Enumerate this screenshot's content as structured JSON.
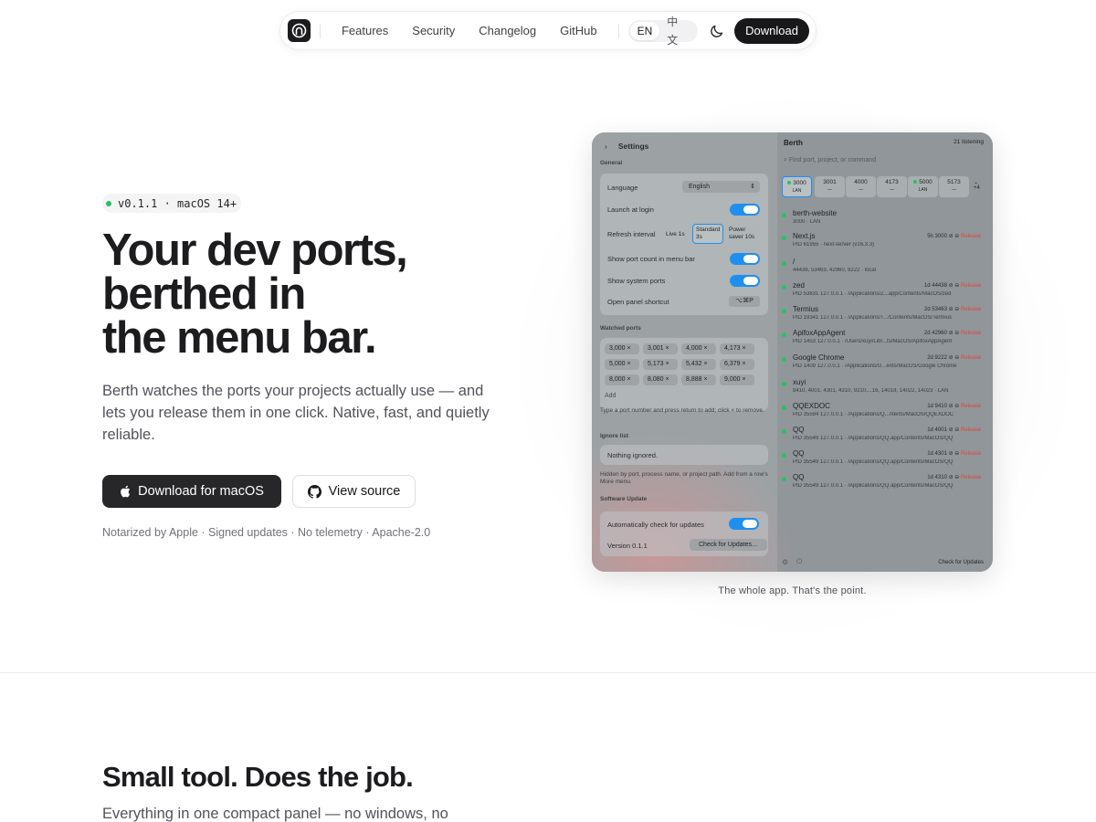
{
  "nav": {
    "links": [
      "Features",
      "Security",
      "Changelog",
      "GitHub"
    ],
    "lang_en": "EN",
    "lang_zh": "中文",
    "download": "Download"
  },
  "hero": {
    "badge": "v0.1.1 · macOS 14+",
    "title_1": "Your dev ports,",
    "title_2": "berthed in",
    "title_3": "the menu bar.",
    "subtitle": "Berth watches the ports your projects actually use — and lets you release them in one click. Native, fast, and quietly reliable.",
    "primary_btn": "Download for macOS",
    "secondary_btn": "View source",
    "trust": "Notarized by Apple · Signed updates · No telemetry · Apache-2.0"
  },
  "app": {
    "settings": {
      "title": "Settings",
      "general": "General",
      "language_label": "Language",
      "language_value": "English",
      "launch_label": "Launch at login",
      "refresh_label": "Refresh interval",
      "refresh_opts": [
        "Live 1s",
        "Standard 3s",
        "Power saver 10s"
      ],
      "menu_count_label": "Show port count in menu bar",
      "system_ports_label": "Show system ports",
      "shortcut_label": "Open panel shortcut",
      "shortcut_value": "⌥⌘P",
      "watched": "Watched ports",
      "chips": [
        "3,000 ×",
        "3,001 ×",
        "4,000 ×",
        "4,173 ×",
        "5,000 ×",
        "5,173 ×",
        "5,432 ×",
        "6,379 ×",
        "8,000 ×",
        "8,080 ×",
        "8,888 ×",
        "9,000 ×"
      ],
      "add": "Add",
      "watched_hint": "Type a port number and press return to add; click × to remove.",
      "ignore": "Ignore list",
      "ignore_empty": "Nothing ignored.",
      "ignore_hint": "Hidden by port, process name, or project path. Add from a row's More menu.",
      "update": "Software Update",
      "auto_update": "Automatically check for updates",
      "version": "Version 0.1.1",
      "check_btn": "Check for Updates…"
    },
    "list": {
      "title": "Berth",
      "count": "21 listening",
      "search": "Find port, project, or command",
      "tabs": [
        {
          "port": "3000",
          "sub": "LAN"
        },
        {
          "port": "3001",
          "sub": "—"
        },
        {
          "port": "4000",
          "sub": "—"
        },
        {
          "port": "4173",
          "sub": "—"
        },
        {
          "port": "5000",
          "sub": "LAN"
        },
        {
          "port": "5173",
          "sub": "—"
        }
      ],
      "tabs_more": "+4",
      "items": [
        {
          "name": "berth-website",
          "det": "3000 · LAN",
          "meta": ""
        },
        {
          "name": "Next.js",
          "det": "PID 61955 · next-server (v16.3.3)",
          "meta": "5h 3000"
        },
        {
          "name": "/",
          "det": "44438, 53463, 42960, 9222 · local",
          "meta": ""
        },
        {
          "name": "zed",
          "det": "PID 53831 127.0.0.1 · /Applications/Z...app/Contents/MacOS/zed",
          "meta": "1d 44438"
        },
        {
          "name": "Termius",
          "det": "PID 19341 127.0.0.1 · /Applications/T.../Contents/MacOS/Termius",
          "meta": "2d 53463"
        },
        {
          "name": "ApifoxAppAgent",
          "det": "PID 1453 127.0.0.1 · /Users/xuyi/Libr...ts/MacOS/ApifoxAppAgent",
          "meta": "2d 42960"
        },
        {
          "name": "Google Chrome",
          "det": "PID 1409 127.0.0.1 · /Applications/G...ents/MacOS/Google Chrome",
          "meta": "2d 9222"
        },
        {
          "name": "xuyi",
          "det": "8410, 4001, 4301, 4310, 9210,...16, 14018, 14022, 14023 · LAN",
          "meta": ""
        },
        {
          "name": "QQEXDOC",
          "det": "PID 35594 127.0.0.1 · /Applications/Q...ntents/MacOS/QQEXDOC",
          "meta": "1d 9410"
        },
        {
          "name": "QQ",
          "det": "PID 35549 127.0.0.1 · /Applications/QQ.app/Contents/MacOS/QQ",
          "meta": "1d 4001"
        },
        {
          "name": "QQ",
          "det": "PID 35549 127.0.0.1 · /Applications/QQ.app/Contents/MacOS/QQ",
          "meta": "1d 4301"
        },
        {
          "name": "QQ",
          "det": "PID 35549 127.0.0.1 · /Applications/QQ.app/Contents/MacOS/QQ",
          "meta": "1d 4310"
        }
      ],
      "release": "Release",
      "footer": "Check for Updates"
    }
  },
  "caption": "The whole app. That's the point.",
  "section2": {
    "title": "Small tool. Does the job.",
    "subtitle": "Everything in one compact panel — no windows, no"
  },
  "colors": {
    "accent": "#1e8ff0",
    "status_green": "#22c55e",
    "release_red": "#e0453a",
    "dark_button": "#27272a"
  }
}
